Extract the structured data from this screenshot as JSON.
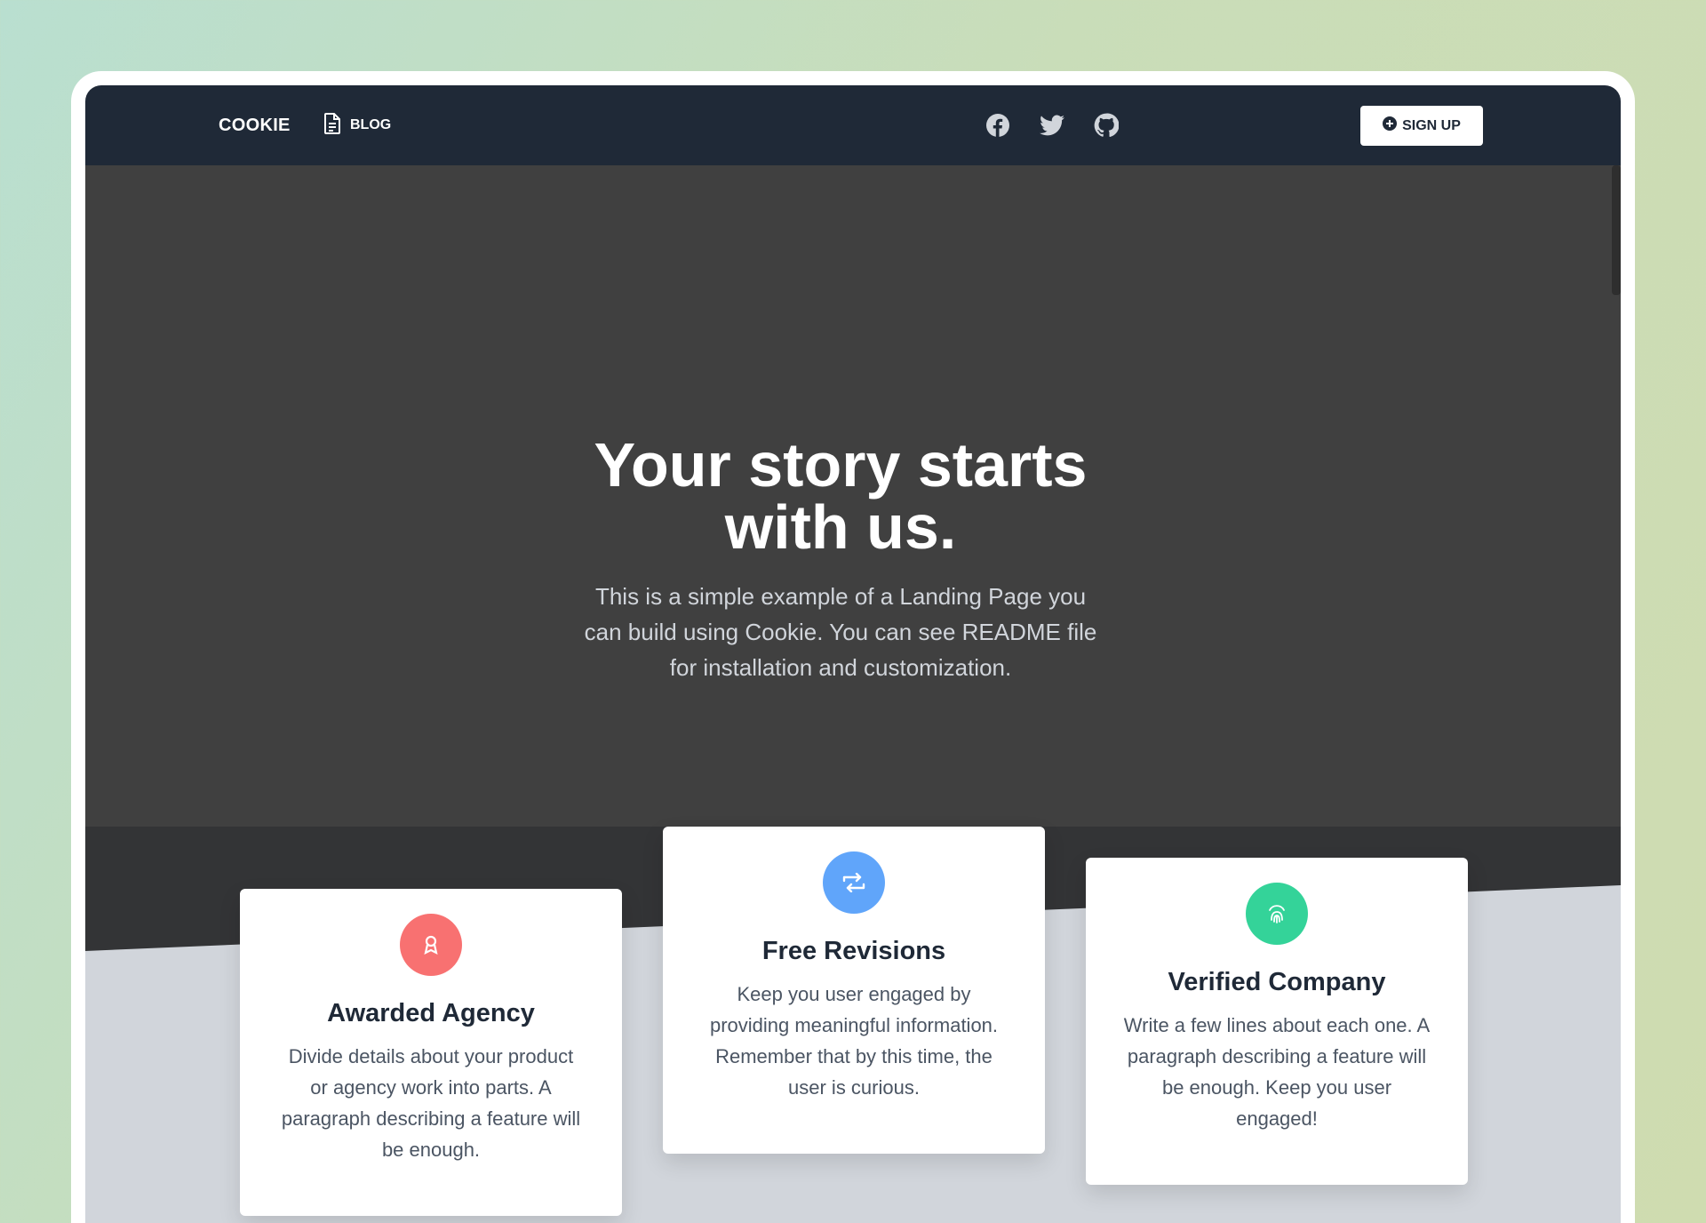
{
  "navbar": {
    "brand": "COOKIE",
    "blog_label": "BLOG",
    "social_icons": [
      "facebook-icon",
      "twitter-icon",
      "github-icon"
    ],
    "signup_label": "SIGN UP"
  },
  "hero": {
    "title": "Your story starts\nwith us.",
    "text": "This is a simple example of a Landing Page you\ncan build using Cookie. You can see README file\nfor installation and customization."
  },
  "features": [
    {
      "title": "Awarded Agency",
      "text": "Divide details about your product\nor agency work into parts. A\nparagraph describing a feature will\nbe enough.",
      "icon": "award-icon",
      "color": "#f87171"
    },
    {
      "title": "Free Revisions",
      "text": "Keep you user engaged by\nproviding meaningful information.\nRemember that by this time, the\nuser is curious.",
      "icon": "retweet-icon",
      "color": "#60a5fa"
    },
    {
      "title": "Verified Company",
      "text": "Write a few lines about each one. A\nparagraph describing a feature will\nbe enough. Keep you user\nengaged!",
      "icon": "fingerprint-icon",
      "color": "#34d399"
    }
  ],
  "colors": {
    "navbar": "#1f2937",
    "hero": "#404040",
    "band": "#333436",
    "section": "#d1d5db"
  }
}
